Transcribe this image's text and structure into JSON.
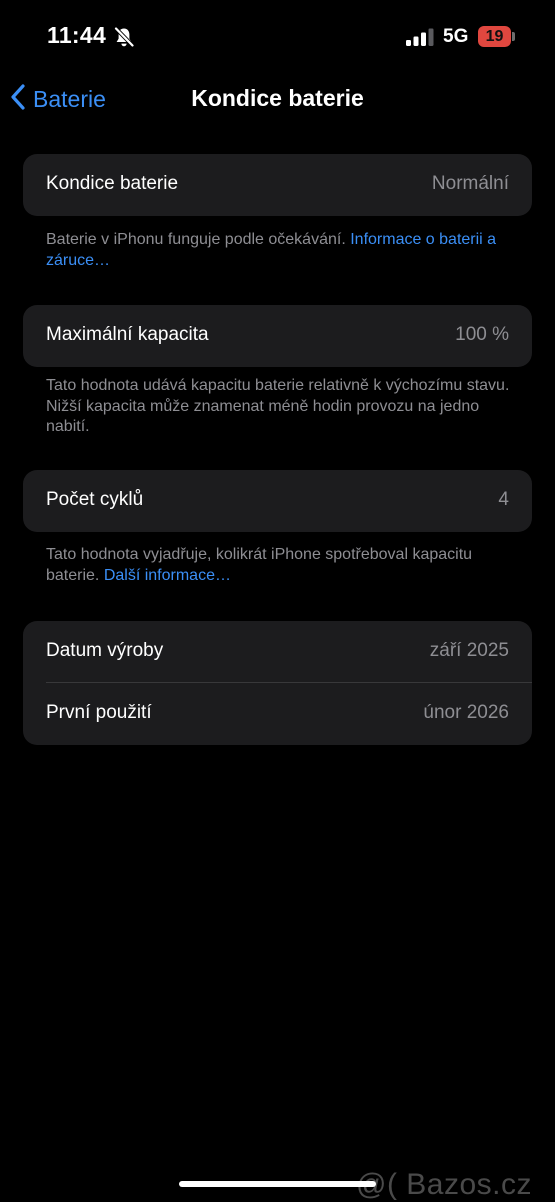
{
  "status_bar": {
    "time": "11:44",
    "network": "5G",
    "battery_level": "19",
    "icons": [
      "bell-slash-icon",
      "cellular-signal-icon",
      "battery-icon"
    ]
  },
  "nav": {
    "back_label": "Baterie",
    "title": "Kondice baterie",
    "back_icon": "chevron-left-icon"
  },
  "health": {
    "label": "Kondice baterie",
    "value": "Normální",
    "note": "Baterie v iPhonu funguje podle očekávání. ",
    "note_link": "Informace o baterii a záruce…"
  },
  "capacity": {
    "label": "Maximální kapacita",
    "value": "100 %",
    "note": "Tato hodnota udává kapacitu baterie relativně k výchozímu stavu. Nižší kapacita může znamenat méně hodin provozu na jedno nabití."
  },
  "cycles": {
    "label": "Počet cyklů",
    "value": "4",
    "note": "Tato hodnota vyjadřuje, kolikrát iPhone spotřeboval kapacitu baterie. ",
    "note_link": "Další informace…"
  },
  "dates": {
    "manufacture_label": "Datum výroby",
    "manufacture_value": "září 2025",
    "first_use_label": "První použití",
    "first_use_value": "únor 2026"
  },
  "watermark": "@( Bazos.cz",
  "colors": {
    "background": "#000000",
    "card": "#1c1c1e",
    "accent": "#3b8ff6",
    "secondary_text": "#8e8e93",
    "battery_low": "#e0473f"
  }
}
